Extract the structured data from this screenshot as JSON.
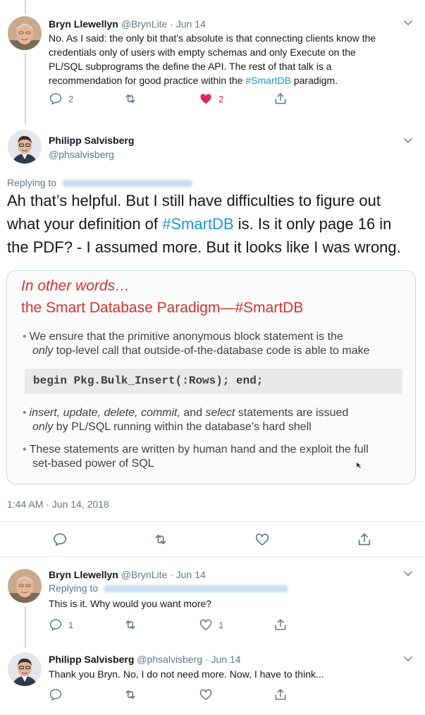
{
  "tweets": [
    {
      "name": "Bryn Llewellyn",
      "handle": "@BrynLite · Jun 14",
      "text_plain": "No. As I said: the only bit that's absolute is that connecting clients know the",
      "line2": "credentials only of users with empty schemas and only Execute on the",
      "line3": "PL/SQL subprograms the define the API. The rest of that talk is a",
      "line4_pre": "recommendation for good practice within the ",
      "hashtag": "#SmartDB",
      "line4_post": " paradigm.",
      "replies": "2",
      "likes": "2"
    },
    {
      "name": "Philipp Salvisberg",
      "handle": "@phsalvisberg",
      "replying_to": "Replying to",
      "line1": "Ah that’s helpful. But I still have difficulties to figure out",
      "line2_pre": "what your definition of ",
      "hashtag": "#SmartDB",
      "line2_post": " is. Is it only page 16 in",
      "line3": "the PDF? - I assumed more. But it looks like I was wrong.",
      "timestamp": "1:44 AM · Jun 14, 2018",
      "slide": {
        "title1": "In other words…",
        "title2": "the Smart Database Paradigm—#SmartDB",
        "b1_l1": "We ensure that the primitive anonymous block statement is the",
        "b1_l2_em": "only",
        "b1_l2": " top-level call that outside-of-the-database code is able to make",
        "code": "begin Pkg.Bulk_Insert(:Rows); end;",
        "b2_em1": "insert, update, delete, commit,",
        "b2_mid": " and ",
        "b2_em2": "select",
        "b2_l1_end": " statements are issued",
        "b2_l2_em": "only",
        "b2_l2": " by PL/SQL running within the database’s hard shell",
        "b3_l1": "These statements are written by human hand and the exploit the full",
        "b3_l2": "set-based power of SQL",
        "bullet": "•"
      }
    },
    {
      "name": "Bryn Llewellyn",
      "handle": "@BrynLite · Jun 14",
      "replying_to": "Replying to",
      "text": "This is it. Why would you want more?",
      "replies": "1",
      "likes": "1"
    },
    {
      "name": "Philipp Salvisberg",
      "handle": "@phsalvisberg · Jun 14",
      "text": "Thank you Bryn. No, I do not need more. Now, I have to think..."
    }
  ],
  "colors": {
    "link": "#1b95e0",
    "muted": "#657786",
    "like": "#e0245e",
    "slide_red": "#d0352c"
  },
  "icons": [
    "chevron-down-icon",
    "reply-icon",
    "retweet-icon",
    "like-icon",
    "share-icon"
  ]
}
